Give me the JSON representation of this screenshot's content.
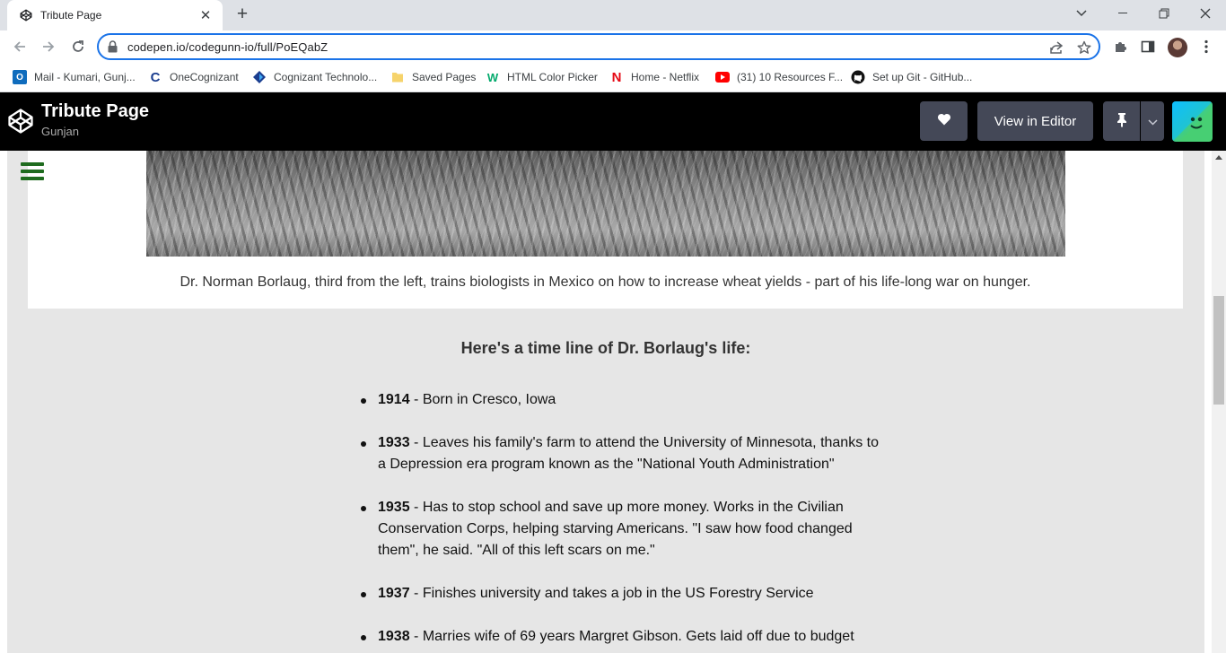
{
  "browser": {
    "tab_title": "Tribute Page",
    "url": "codepen.io/codegunn-io/full/PoEQabZ",
    "bookmarks": [
      {
        "label": "Mail - Kumari, Gunj...",
        "icon": "outlook-icon"
      },
      {
        "label": "OneCognizant",
        "icon": "cognizant-c-icon"
      },
      {
        "label": "Cognizant Technolo...",
        "icon": "cognizant-icon"
      },
      {
        "label": "Saved Pages",
        "icon": "folder-icon"
      },
      {
        "label": "HTML Color Picker",
        "icon": "w3schools-icon"
      },
      {
        "label": "Home - Netflix",
        "icon": "netflix-icon"
      },
      {
        "label": "(31) 10 Resources F...",
        "icon": "youtube-icon"
      },
      {
        "label": "Set up Git - GitHub...",
        "icon": "github-icon"
      }
    ]
  },
  "codepen": {
    "title": "Tribute Page",
    "author": "Gunjan",
    "view_in_editor": "View in Editor"
  },
  "content": {
    "caption": "Dr. Norman Borlaug, third from the left, trains biologists in Mexico on how to increase wheat yields - part of his life-long war on hunger.",
    "timeline_heading": "Here's a time line of Dr. Borlaug's life:",
    "timeline": [
      {
        "year": "1914",
        "text": " - Born in Cresco, Iowa"
      },
      {
        "year": "1933",
        "text": " - Leaves his family's farm to attend the University of Minnesota, thanks to a Depression era program known as the \"National Youth Administration\""
      },
      {
        "year": "1935",
        "text": " - Has to stop school and save up more money. Works in the Civilian Conservation Corps, helping starving Americans. \"I saw how food changed them\", he said. \"All of this left scars on me.\""
      },
      {
        "year": "1937",
        "text": " - Finishes university and takes a job in the US Forestry Service"
      },
      {
        "year": "1938",
        "text": " - Marries wife of 69 years Margret Gibson. Gets laid off due to budget"
      }
    ]
  },
  "colors": {
    "accent": "#1a73e8",
    "codepen_bg": "#000000",
    "codepen_button": "#444857",
    "page_bg": "#e6e6e6",
    "menu_green": "#1e6b1e"
  }
}
